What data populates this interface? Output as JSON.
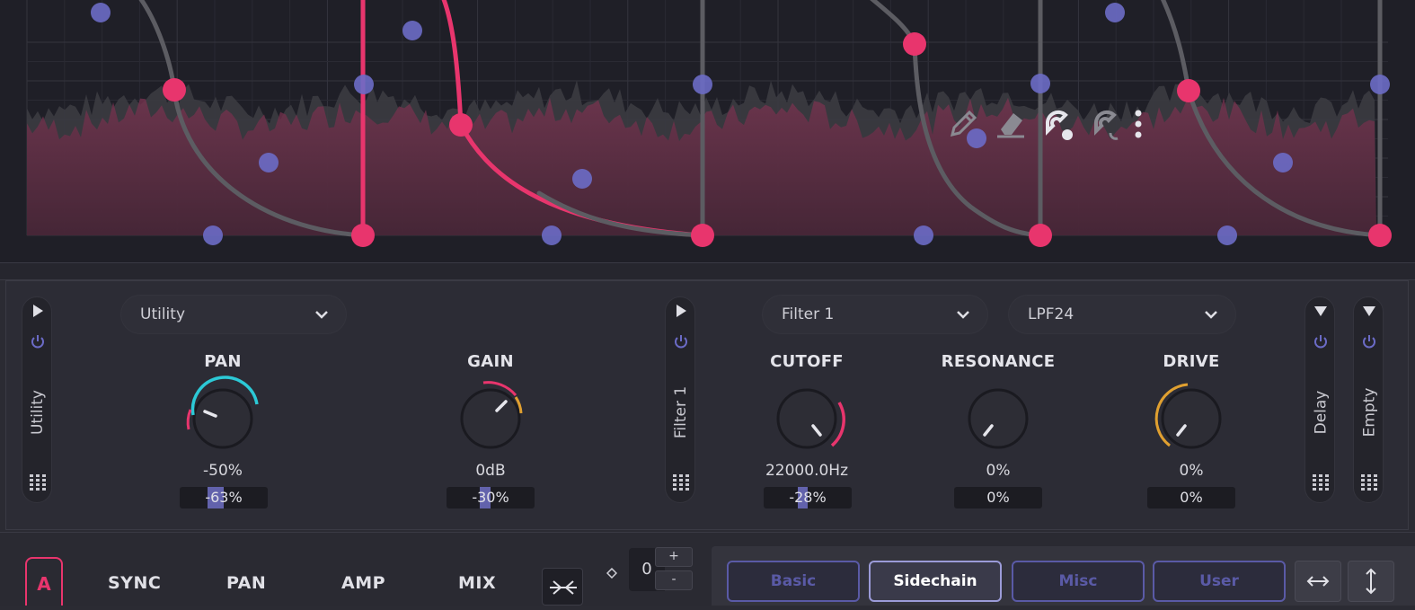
{
  "envelope_tools": {
    "icons": [
      "pencil-icon",
      "eraser-icon",
      "magnet-icon",
      "magnet-off-icon",
      "more-options-icon"
    ]
  },
  "colors": {
    "accent": "#e8356d",
    "node_blue": "#6b6bc6",
    "mod_blue": "#6f6fc4",
    "pan_ring": "#2cc9d6",
    "drive_ring": "#e0a030",
    "background": "#1f1f27"
  },
  "devices": {
    "utility_strip": {
      "label": "Utility"
    },
    "filter_strip": {
      "label": "Filter 1"
    },
    "delay_strip": {
      "label": "Delay"
    },
    "empty_strip": {
      "label": "Empty"
    },
    "utility_dropdown": "Utility",
    "filter_dropdown": "Filter 1",
    "filter_type_dropdown": "LPF24"
  },
  "knobs": {
    "pan": {
      "title": "PAN",
      "value": "-50%",
      "mod": "-63%",
      "mod_fraction": -0.63
    },
    "gain": {
      "title": "GAIN",
      "value": "0dB",
      "mod": "-30%",
      "mod_fraction": -0.3
    },
    "cutoff": {
      "title": "CUTOFF",
      "value": "22000.0Hz",
      "mod": "-28%",
      "mod_fraction": -0.28
    },
    "resonance": {
      "title": "RESONANCE",
      "value": "0%",
      "mod": "0%",
      "mod_fraction": 0
    },
    "drive": {
      "title": "DRIVE",
      "value": "0%",
      "mod": "0%",
      "mod_fraction": 0
    }
  },
  "bottom": {
    "a_button": "A",
    "sync": "SYNC",
    "pan": "PAN",
    "amp": "AMP",
    "mix": "MIX",
    "offset_value": "0",
    "step_up": "+",
    "step_down": "-",
    "tabs": [
      "Basic",
      "Sidechain",
      "Misc",
      "User"
    ],
    "active_tab": "Sidechain"
  }
}
